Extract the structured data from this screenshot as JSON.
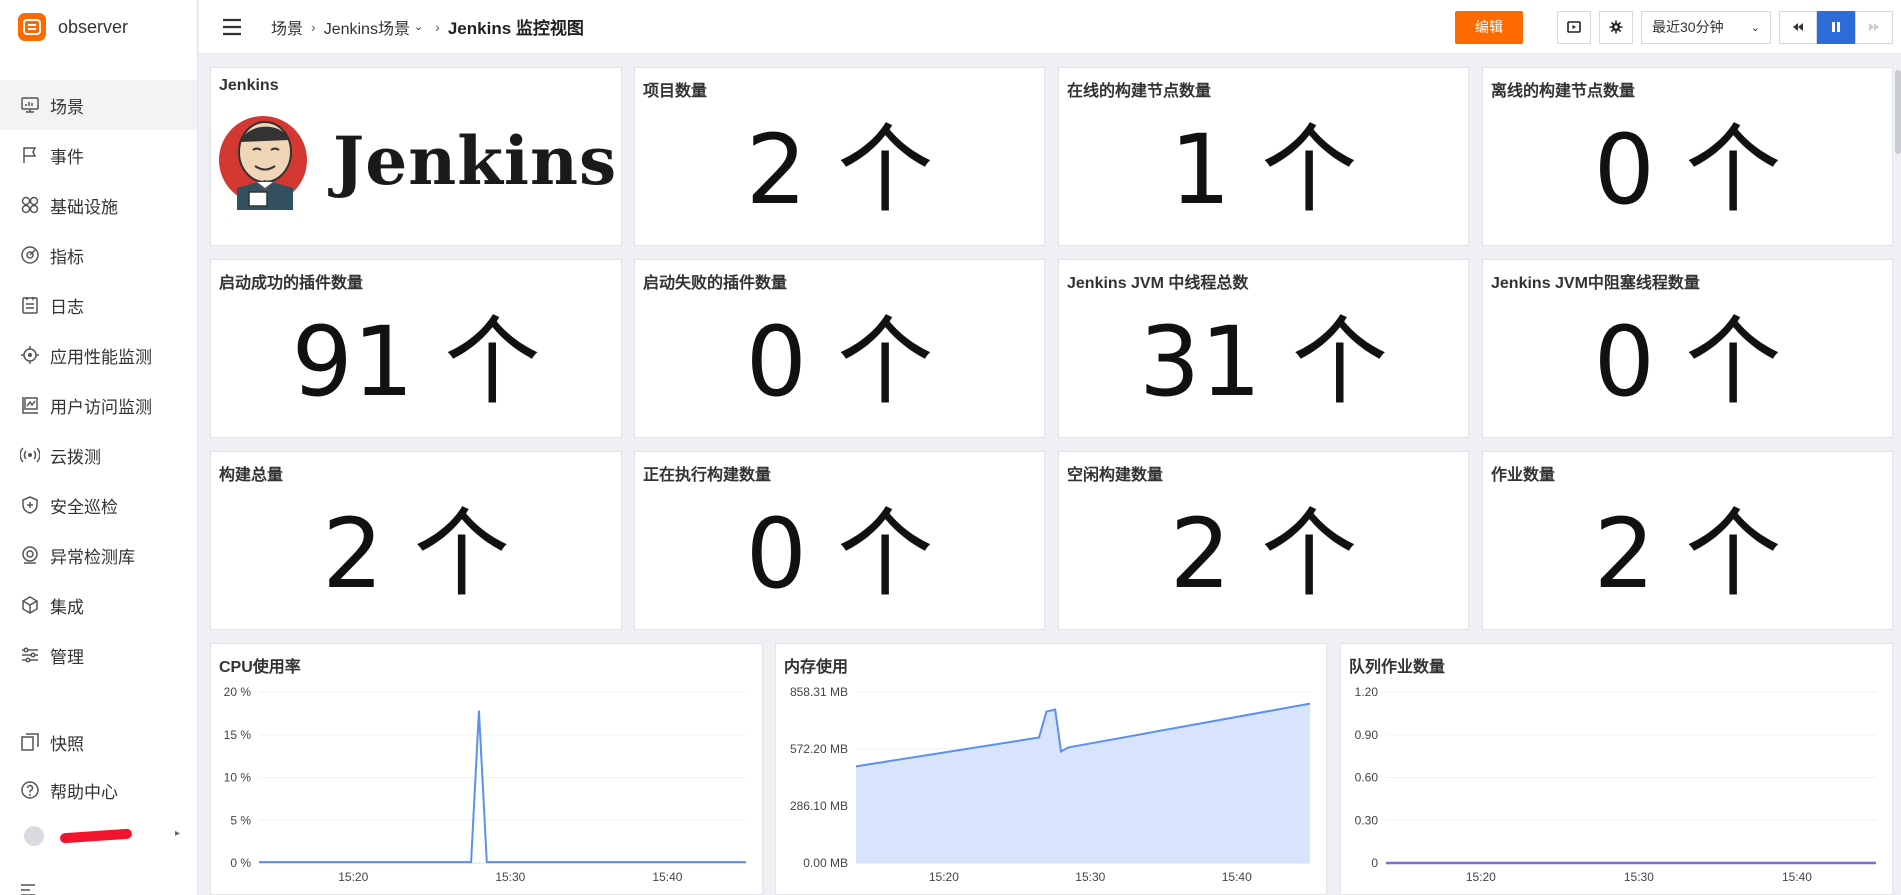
{
  "app": {
    "name": "observer"
  },
  "sidebar": {
    "items": [
      {
        "label": "场景",
        "icon": "monitor-icon"
      },
      {
        "label": "事件",
        "icon": "flag-icon"
      },
      {
        "label": "基础设施",
        "icon": "grid-icon"
      },
      {
        "label": "指标",
        "icon": "target-icon"
      },
      {
        "label": "日志",
        "icon": "clipboard-icon"
      },
      {
        "label": "应用性能监测",
        "icon": "aperture-icon"
      },
      {
        "label": "用户访问监测",
        "icon": "chart-frame-icon"
      },
      {
        "label": "云拨测",
        "icon": "broadcast-icon"
      },
      {
        "label": "安全巡检",
        "icon": "shield-icon"
      },
      {
        "label": "异常检测库",
        "icon": "radar-icon"
      },
      {
        "label": "集成",
        "icon": "cube-icon"
      },
      {
        "label": "管理",
        "icon": "sliders-icon"
      }
    ],
    "bottom_items": [
      {
        "label": "快照",
        "icon": "snapshot-icon"
      },
      {
        "label": "帮助中心",
        "icon": "help-icon"
      }
    ]
  },
  "header": {
    "breadcrumb": [
      "场景",
      "Jenkins场景",
      "Jenkins 监控视图"
    ],
    "edit_label": "编辑",
    "time_range": "最近30分钟"
  },
  "stats": [
    {
      "title": "项目数量",
      "value": "2 个"
    },
    {
      "title": "在线的构建节点数量",
      "value": "1 个"
    },
    {
      "title": "离线的构建节点数量",
      "value": "0 个"
    },
    {
      "title": "启动成功的插件数量",
      "value": "91 个"
    },
    {
      "title": "启动失败的插件数量",
      "value": "0 个"
    },
    {
      "title": "Jenkins JVM 中线程总数",
      "value": "31 个"
    },
    {
      "title": "Jenkins JVM中阻塞线程数量",
      "value": "0 个"
    },
    {
      "title": "构建总量",
      "value": "2 个"
    },
    {
      "title": "正在执行构建数量",
      "value": "0 个"
    },
    {
      "title": "空闲构建数量",
      "value": "2 个"
    },
    {
      "title": "作业数量",
      "value": "2 个"
    }
  ],
  "logo_card": {
    "title": "Jenkins",
    "logo_text": "Jenkins"
  },
  "colors": {
    "accent": "#ff6a00",
    "primary": "#2d6bd8",
    "line": "#5b8ff0",
    "area": "#d8e4fb",
    "queue_line": "#7b6fd0"
  },
  "chart_data": [
    {
      "type": "line",
      "title": "CPU使用率",
      "y_ticks": [
        "0 %",
        "5 %",
        "10 %",
        "15 %",
        "20 %"
      ],
      "ylim": [
        0,
        20
      ],
      "x_ticks": [
        "15:20",
        "15:30",
        "15:40"
      ],
      "x": [
        "15:14",
        "15:27",
        "15:27.5",
        "15:28",
        "15:28.5",
        "15:45"
      ],
      "series": [
        {
          "values": [
            0.1,
            0.1,
            0.1,
            17.8,
            0.1,
            0.1
          ]
        }
      ]
    },
    {
      "type": "area",
      "title": "内存使用",
      "y_ticks": [
        "0.00 MB",
        "286.10 MB",
        "572.20 MB",
        "858.31 MB"
      ],
      "ylim": [
        0,
        858.31
      ],
      "x_ticks": [
        "15:20",
        "15:30",
        "15:40"
      ],
      "x": [
        "15:14",
        "15:26.5",
        "15:27",
        "15:27.6",
        "15:28",
        "15:28.5",
        "15:45"
      ],
      "series": [
        {
          "values": [
            485,
            630,
            760,
            770,
            560,
            580,
            800
          ]
        }
      ]
    },
    {
      "type": "line",
      "title": "队列作业数量",
      "y_ticks": [
        "0",
        "0.30",
        "0.60",
        "0.90",
        "1.20"
      ],
      "ylim": [
        0,
        1.2
      ],
      "x_ticks": [
        "15:20",
        "15:30",
        "15:40"
      ],
      "x": [
        "15:14",
        "15:45"
      ],
      "series": [
        {
          "values": [
            0,
            0
          ]
        }
      ]
    }
  ]
}
